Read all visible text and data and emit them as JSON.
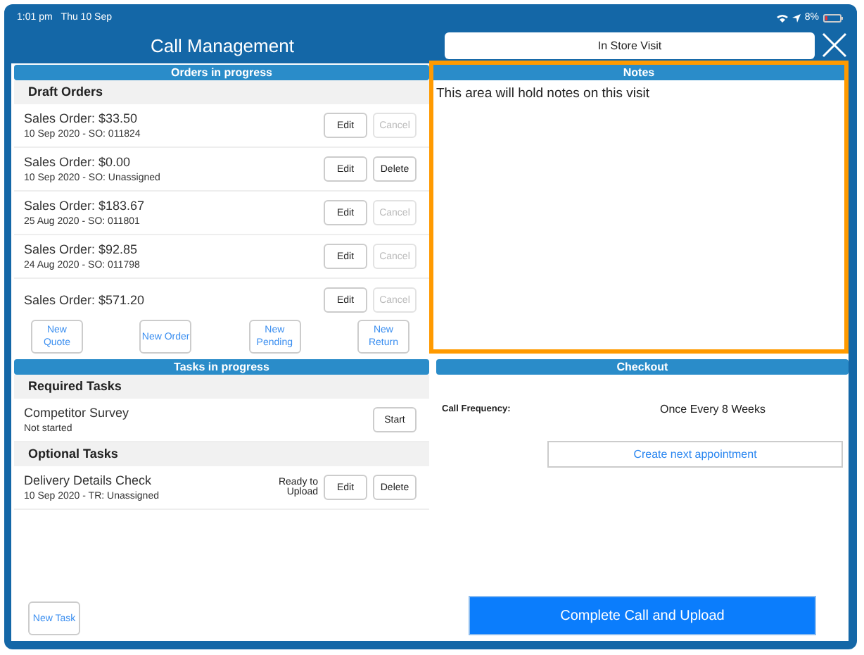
{
  "status_bar": {
    "time": "1:01 pm",
    "date": "Thu 10 Sep",
    "battery": "8%"
  },
  "header": {
    "title": "Call Management",
    "visit_type": "In Store Visit"
  },
  "orders": {
    "title": "Orders in progress",
    "section": "Draft Orders",
    "rows": [
      {
        "title": "Sales Order: $33.50",
        "subtitle": "10 Sep 2020 - SO: 011824",
        "buttons": [
          {
            "label": "Edit",
            "disabled": false
          },
          {
            "label": "Cancel",
            "disabled": true
          }
        ]
      },
      {
        "title": "Sales Order: $0.00",
        "subtitle": "10 Sep 2020 - SO: Unassigned",
        "buttons": [
          {
            "label": "Edit",
            "disabled": false
          },
          {
            "label": "Delete",
            "disabled": false
          }
        ]
      },
      {
        "title": "Sales Order: $183.67",
        "subtitle": "25 Aug 2020 - SO: 011801",
        "buttons": [
          {
            "label": "Edit",
            "disabled": false
          },
          {
            "label": "Cancel",
            "disabled": true
          }
        ]
      },
      {
        "title": "Sales Order: $92.85",
        "subtitle": "24 Aug 2020 - SO: 011798",
        "buttons": [
          {
            "label": "Edit",
            "disabled": false
          },
          {
            "label": "Cancel",
            "disabled": true
          }
        ]
      },
      {
        "title": "Sales Order: $571.20",
        "buttons": [
          {
            "label": "Edit",
            "disabled": false
          },
          {
            "label": "Cancel",
            "disabled": true
          }
        ]
      }
    ],
    "actions": [
      "New Quote",
      "New Order",
      "New Pending",
      "New Return"
    ]
  },
  "tasks": {
    "title": "Tasks in progress",
    "groups": [
      {
        "title": "Required Tasks",
        "items": [
          {
            "title": "Competitor Survey",
            "subtitle": "Not started",
            "buttons": [
              {
                "label": "Start",
                "disabled": false
              }
            ]
          }
        ]
      },
      {
        "title": "Optional Tasks",
        "items": [
          {
            "title": "Delivery Details Check",
            "subtitle": "10 Sep 2020 - TR: Unassigned",
            "status": "Ready to Upload",
            "buttons": [
              {
                "label": "Edit",
                "disabled": false
              },
              {
                "label": "Delete",
                "disabled": false
              }
            ]
          }
        ]
      }
    ],
    "new_task": "New Task"
  },
  "notes": {
    "title": "Notes",
    "text": "This area will hold notes on this visit",
    "highlighted": true
  },
  "checkout": {
    "title": "Checkout",
    "frequency_label": "Call Frequency:",
    "frequency_value": "Once Every 8 Weeks",
    "appointment_button": "Create next appointment",
    "complete_button": "Complete Call and Upload"
  }
}
